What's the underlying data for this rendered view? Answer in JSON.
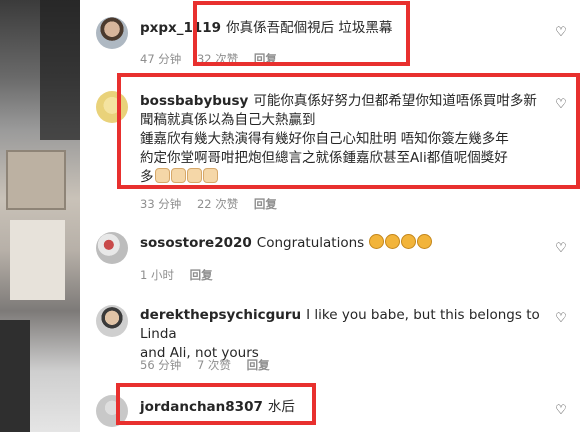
{
  "comments": [
    {
      "username": "pxpx_1119",
      "text": "你真係吾配個視后 垃圾黑幕",
      "time": "47 分钟",
      "likes": "32 次赞",
      "reply": "回复"
    },
    {
      "username": "bossbabybusy",
      "text": "可能你真係好努力但都希望你知道唔係買咁多新聞稿就真係以為自己大熱贏到",
      "text_line2": "鍾嘉欣有幾大熱演得有幾好你自己心知肚明 唔知你簽左幾多年",
      "text_line3": "約定你堂啊哥咁把炮但總言之就係鍾嘉欣甚至Ali都值呢個獎好",
      "text_line4_prefix": "多",
      "emojis": [
        "pray",
        "pray",
        "pray",
        "pray"
      ],
      "time": "33 分钟",
      "likes": "22 次赞",
      "reply": "回复"
    },
    {
      "username": "sosostore2020",
      "text": "Congratulations",
      "emojis": [
        "clap",
        "clap",
        "clap",
        "clap"
      ],
      "time": "1 小时",
      "reply": "回复"
    },
    {
      "username": "derekthepsychicguru",
      "text": "I like you babe, but this belongs to Linda",
      "text_line2": "and Ali, not yours",
      "time": "56 分钟",
      "likes": "7 次赞",
      "reply": "回复"
    },
    {
      "username": "jordanchan8307",
      "text": "水后"
    }
  ],
  "icons": {
    "like": "heart-outline-icon"
  },
  "colors": {
    "highlight": "#e8302e",
    "meta": "#8e8e8e",
    "text": "#262626"
  }
}
